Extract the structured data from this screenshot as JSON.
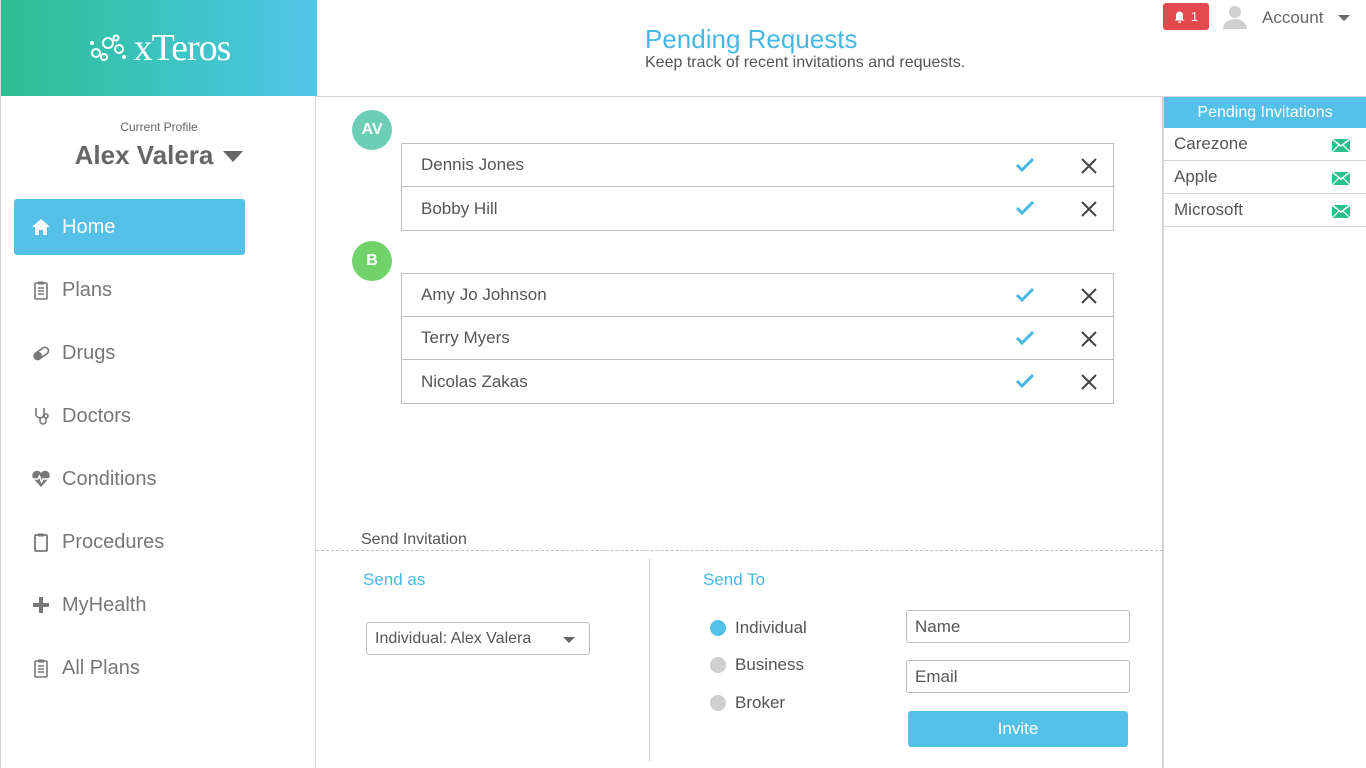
{
  "brand": {
    "name": "xTeros"
  },
  "profile": {
    "label": "Current Profile",
    "name": "Alex Valera"
  },
  "nav": [
    {
      "label": "Home",
      "icon": "home-icon",
      "active": true
    },
    {
      "label": "Plans",
      "icon": "clipboard-icon"
    },
    {
      "label": "Drugs",
      "icon": "pill-icon"
    },
    {
      "label": "Doctors",
      "icon": "stethoscope-icon"
    },
    {
      "label": "Conditions",
      "icon": "heartbeat-icon"
    },
    {
      "label": "Procedures",
      "icon": "clipboard-check-icon"
    },
    {
      "label": "MyHealth",
      "icon": "plus-icon"
    },
    {
      "label": "All Plans",
      "icon": "list-clipboard-icon"
    }
  ],
  "header": {
    "title": "Pending Requests",
    "subtitle": "Keep track of recent invitations and requests.",
    "notification_count": "1",
    "account_label": "Account"
  },
  "groups": [
    {
      "badge": "AV",
      "color": "#6ccfb5",
      "requests": [
        "Dennis Jones",
        "Bobby Hill"
      ]
    },
    {
      "badge": "B",
      "color": "#6fd36a",
      "requests": [
        "Amy Jo Johnson",
        "Terry Myers",
        "Nicolas Zakas"
      ]
    }
  ],
  "invite": {
    "section_label": "Send Invitation",
    "send_as_label": "Send as",
    "send_as_value": "Individual: Alex Valera",
    "send_to_label": "Send To",
    "options": [
      "Individual",
      "Business",
      "Broker"
    ],
    "selected_option": "Individual",
    "name_placeholder": "Name",
    "email_placeholder": "Email",
    "invite_button": "Invite"
  },
  "pending_invitations": {
    "title": "Pending Invitations",
    "items": [
      "Carezone",
      "Apple",
      "Microsoft"
    ]
  },
  "colors": {
    "accent": "#55c1e8",
    "accent_text": "#45b8e3",
    "alert": "#e34a50",
    "check": "#45b8e3",
    "mail": "#2dbe8f"
  }
}
